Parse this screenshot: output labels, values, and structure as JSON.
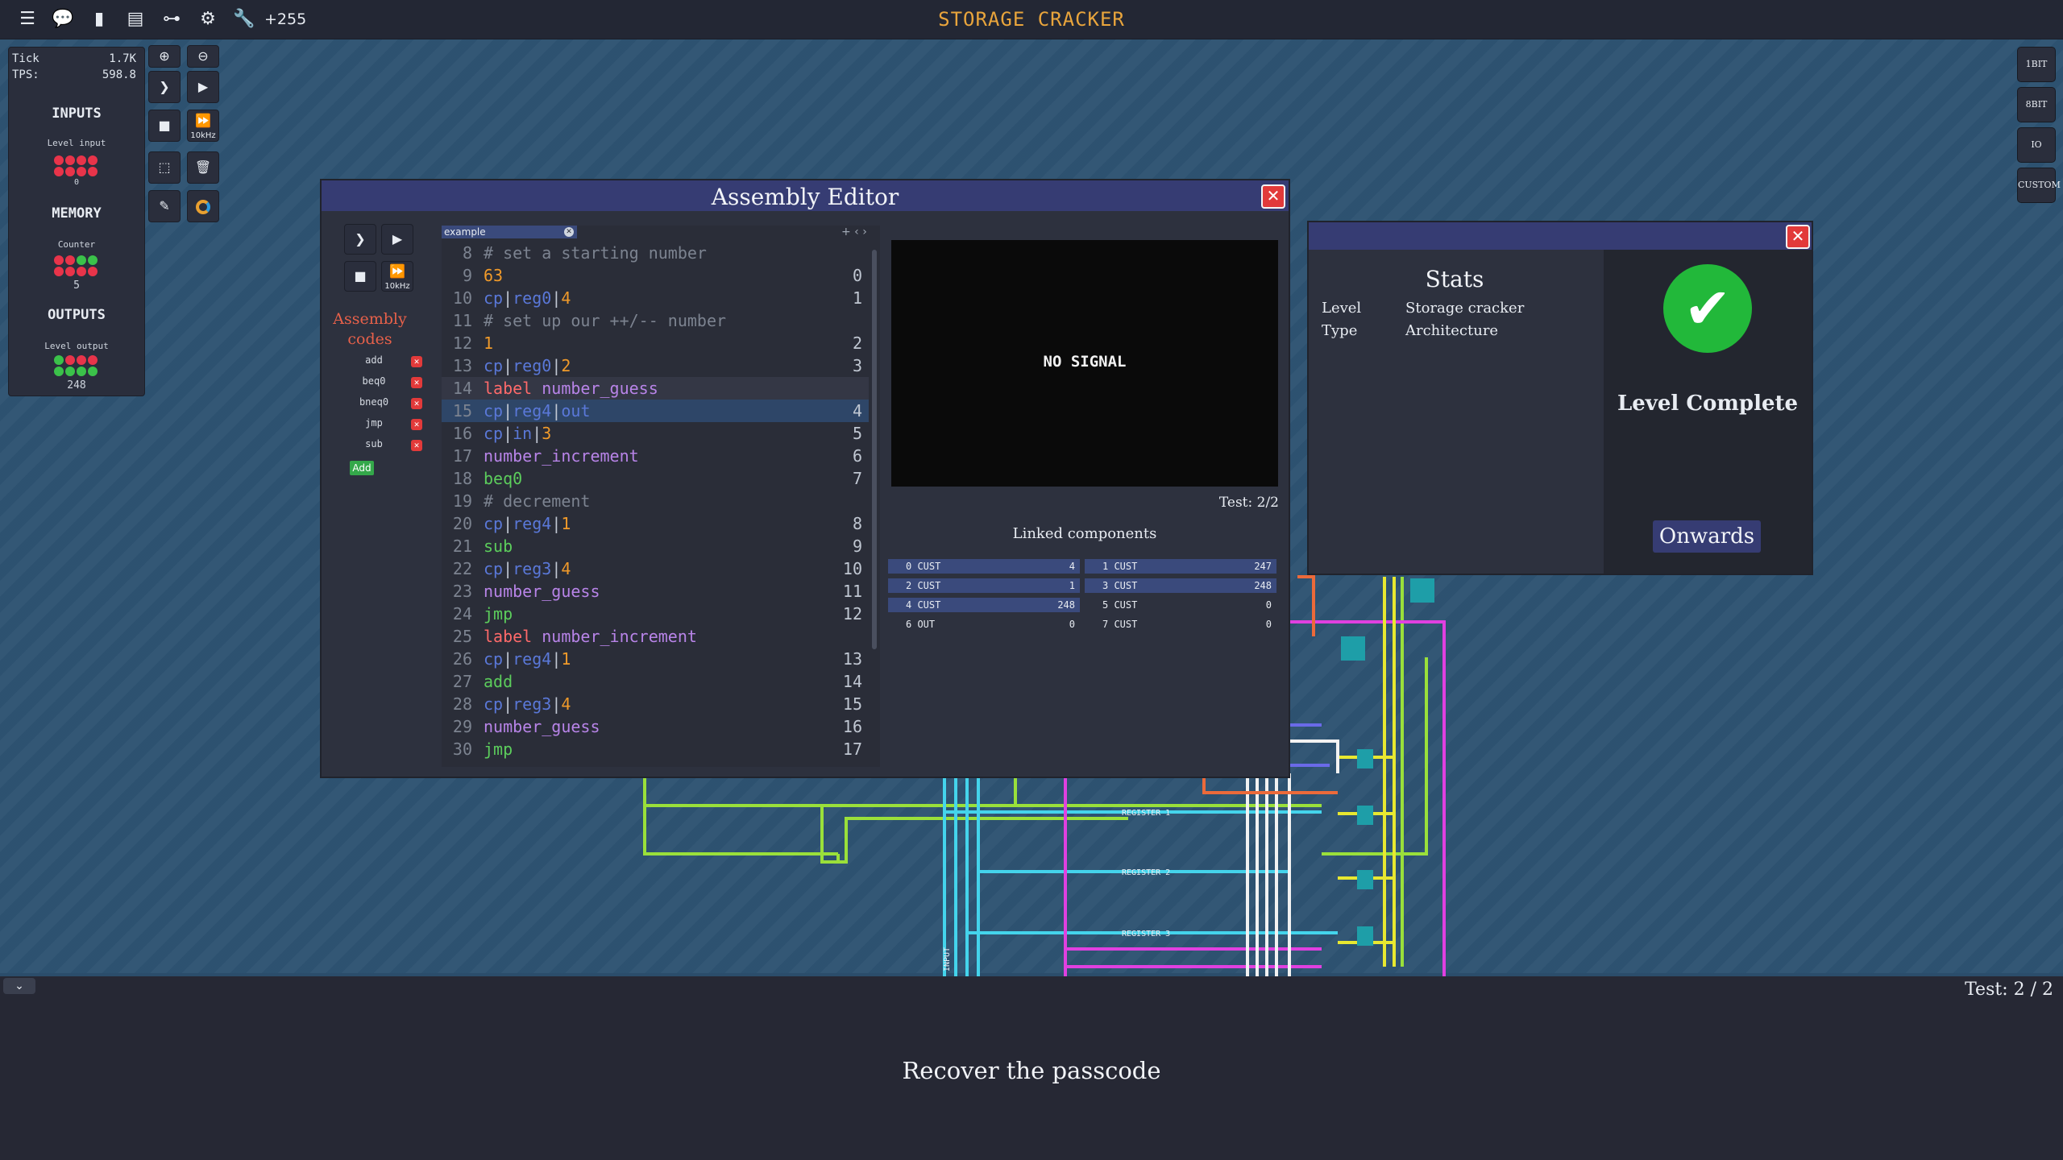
{
  "app": {
    "title": "STORAGE CRACKER",
    "notification_count": "+255"
  },
  "topbar": {
    "icons": [
      "menu-icon",
      "chat-icon",
      "file-icon",
      "book-icon",
      "hierarchy-icon",
      "gear-icon",
      "wrench-icon"
    ]
  },
  "sim": {
    "tick_label": "Tick",
    "tick_value": "1.7K",
    "tps_label": "TPS:",
    "tps_value": "598.8",
    "speed_label": "10kHz"
  },
  "left_panel": {
    "inputs_title": "INPUTS",
    "level_input_label": "Level input",
    "level_input_value": "0",
    "memory_title": "MEMORY",
    "counter_label": "Counter",
    "counter_value": "5",
    "outputs_title": "OUTPUTS",
    "level_output_label": "Level output",
    "level_output_value": "248"
  },
  "right_buttons": [
    "1BIT",
    "8BIT",
    "IO",
    "CUSTOM"
  ],
  "editor": {
    "title": "Assembly Editor",
    "speed_label": "10kHz",
    "codes_title": "Assembly codes",
    "codes": [
      "add",
      "beq0",
      "bneq0",
      "jmp",
      "sub"
    ],
    "add_label": "Add",
    "tab_name": "example",
    "tab_nav": "+ ‹ ›",
    "lines": [
      {
        "ln": "8",
        "text": "# set a starting number",
        "idx": ""
      },
      {
        "ln": "9",
        "text": "63",
        "idx": "0"
      },
      {
        "ln": "10",
        "text": "cp|reg0|4",
        "idx": "1"
      },
      {
        "ln": "11",
        "text": "# set up our ++/-- number",
        "idx": ""
      },
      {
        "ln": "12",
        "text": "1",
        "idx": "2"
      },
      {
        "ln": "13",
        "text": "cp|reg0|2",
        "idx": "3"
      },
      {
        "ln": "14",
        "text": "label number_guess",
        "idx": ""
      },
      {
        "ln": "15",
        "text": "cp|reg4|out",
        "idx": "4"
      },
      {
        "ln": "16",
        "text": "cp|in|3",
        "idx": "5"
      },
      {
        "ln": "17",
        "text": "number_increment",
        "idx": "6"
      },
      {
        "ln": "18",
        "text": "beq0",
        "idx": "7"
      },
      {
        "ln": "19",
        "text": "# decrement",
        "idx": ""
      },
      {
        "ln": "20",
        "text": "cp|reg4|1",
        "idx": "8"
      },
      {
        "ln": "21",
        "text": "sub",
        "idx": "9"
      },
      {
        "ln": "22",
        "text": "cp|reg3|4",
        "idx": "10"
      },
      {
        "ln": "23",
        "text": "number_guess",
        "idx": "11"
      },
      {
        "ln": "24",
        "text": "jmp",
        "idx": "12"
      },
      {
        "ln": "25",
        "text": "label number_increment",
        "idx": ""
      },
      {
        "ln": "26",
        "text": "cp|reg4|1",
        "idx": "13"
      },
      {
        "ln": "27",
        "text": "add",
        "idx": "14"
      },
      {
        "ln": "28",
        "text": "cp|reg3|4",
        "idx": "15"
      },
      {
        "ln": "29",
        "text": "number_guess",
        "idx": "16"
      },
      {
        "ln": "30",
        "text": "jmp",
        "idx": "17"
      }
    ],
    "screen_text": "NO SIGNAL",
    "test_label": "Test: 2/2",
    "linked_title": "Linked components",
    "linked": [
      {
        "n": "0 CUST",
        "v": "4"
      },
      {
        "n": "1 CUST",
        "v": "247"
      },
      {
        "n": "2 CUST",
        "v": "1"
      },
      {
        "n": "3 CUST",
        "v": "248"
      },
      {
        "n": "4 CUST",
        "v": "248"
      },
      {
        "n": "5 CUST",
        "v": "0"
      },
      {
        "n": "6 OUT",
        "v": "0"
      },
      {
        "n": "7 CUST",
        "v": "0"
      }
    ]
  },
  "stats": {
    "title": "Stats",
    "level_key": "Level",
    "level_value": "Storage cracker",
    "type_key": "Type",
    "type_value": "Architecture",
    "complete_text": "Level Complete",
    "onwards_label": "Onwards"
  },
  "circuit_labels": [
    "REGISTER 1",
    "REGISTER 2",
    "REGISTER 3",
    "INPUT"
  ],
  "bottom": {
    "test_label": "Test: 2 / 2",
    "description": "Recover the passcode"
  },
  "colors": {
    "title_orange": "#e9a53c",
    "header_blue": "#363c73",
    "wire_green": "#9ae03a",
    "wire_cyan": "#44d4ec",
    "wire_magenta": "#e040e0",
    "wire_yellow": "#e8e830",
    "complete_green": "#22b83a",
    "close_red": "#e23a3a"
  }
}
